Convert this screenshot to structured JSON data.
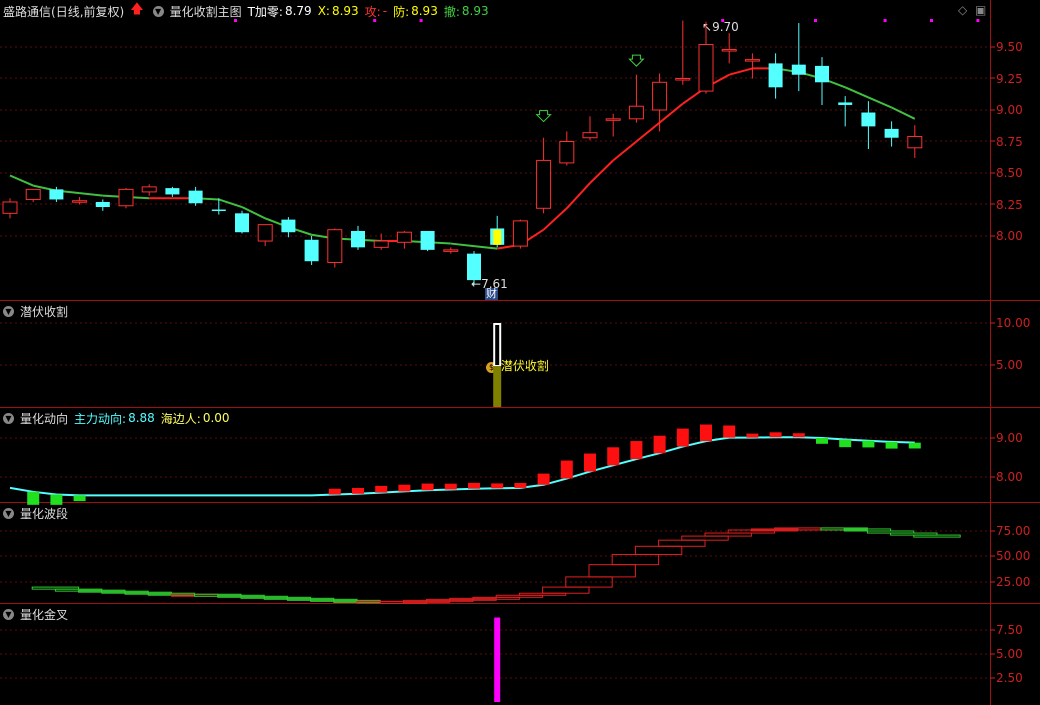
{
  "main": {
    "stock": "盛路通信",
    "period": "(日线,前复权)",
    "indicator": "量化收割主图",
    "t_label": "T加零:",
    "t_value": "8.79",
    "x_label": "X:",
    "x_value": "8.93",
    "gong_label": "攻:",
    "gong_value": "-",
    "fang_label": "防:",
    "fang_value": "8.93",
    "che_label": "撤:",
    "che_value": "8.93",
    "high_marker": "9.70",
    "low_marker": "7.61",
    "cai_label": "财",
    "y_ticks": [
      "9.50",
      "9.25",
      "9.00",
      "8.75",
      "8.50",
      "8.25",
      "8.00"
    ]
  },
  "pane2": {
    "title": "潜伏收割",
    "signal_label": "潜伏收割",
    "y_ticks": [
      "10.00",
      "5.00"
    ]
  },
  "pane3": {
    "title": "量化动向",
    "s1_label": "主力动向:",
    "s1_value": "8.88",
    "s2_label": "海边人:",
    "s2_value": "0.00",
    "y_ticks": [
      "9.00",
      "8.00"
    ]
  },
  "pane4": {
    "title": "量化波段",
    "y_ticks": [
      "75.00",
      "50.00",
      "25.00"
    ]
  },
  "pane5": {
    "title": "量化金叉",
    "y_ticks": [
      "7.50",
      "5.00",
      "2.50"
    ]
  },
  "colors": {
    "up": "#ff3030",
    "down": "#54ffff",
    "ma_up": "#ff2020",
    "ma_down": "#40c040",
    "magenta": "#ff00ff",
    "yellow": "#ffff00",
    "axis": "#cc2020"
  },
  "chart_data": {
    "type": "candlestick",
    "candles": [
      {
        "o": 8.18,
        "h": 8.3,
        "l": 8.14,
        "c": 8.27
      },
      {
        "o": 8.29,
        "h": 8.37,
        "l": 8.27,
        "c": 8.37
      },
      {
        "o": 8.37,
        "h": 8.39,
        "l": 8.27,
        "c": 8.29
      },
      {
        "o": 8.27,
        "h": 8.31,
        "l": 8.25,
        "c": 8.28
      },
      {
        "o": 8.27,
        "h": 8.29,
        "l": 8.2,
        "c": 8.23
      },
      {
        "o": 8.24,
        "h": 8.38,
        "l": 8.22,
        "c": 8.37
      },
      {
        "o": 8.35,
        "h": 8.41,
        "l": 8.32,
        "c": 8.39
      },
      {
        "o": 8.38,
        "h": 8.39,
        "l": 8.31,
        "c": 8.33
      },
      {
        "o": 8.36,
        "h": 8.39,
        "l": 8.24,
        "c": 8.26
      },
      {
        "o": 8.21,
        "h": 8.3,
        "l": 8.17,
        "c": 8.2
      },
      {
        "o": 8.18,
        "h": 8.2,
        "l": 8.02,
        "c": 8.03
      },
      {
        "o": 7.96,
        "h": 8.09,
        "l": 7.92,
        "c": 8.09
      },
      {
        "o": 8.13,
        "h": 8.15,
        "l": 7.99,
        "c": 8.03
      },
      {
        "o": 7.97,
        "h": 8.0,
        "l": 7.77,
        "c": 7.8
      },
      {
        "o": 7.79,
        "h": 8.06,
        "l": 7.75,
        "c": 8.05
      },
      {
        "o": 8.04,
        "h": 8.08,
        "l": 7.89,
        "c": 7.91
      },
      {
        "o": 7.91,
        "h": 8.02,
        "l": 7.89,
        "c": 7.96
      },
      {
        "o": 7.95,
        "h": 8.04,
        "l": 7.9,
        "c": 8.03
      },
      {
        "o": 8.04,
        "h": 8.04,
        "l": 7.88,
        "c": 7.89
      },
      {
        "o": 7.89,
        "h": 7.91,
        "l": 7.86,
        "c": 7.89
      },
      {
        "o": 7.86,
        "h": 7.88,
        "l": 7.61,
        "c": 7.65
      },
      {
        "o": 8.06,
        "h": 8.16,
        "l": 7.91,
        "c": 7.93
      },
      {
        "o": 7.92,
        "h": 8.13,
        "l": 7.9,
        "c": 8.12
      },
      {
        "o": 8.22,
        "h": 8.78,
        "l": 8.18,
        "c": 8.6
      },
      {
        "o": 8.58,
        "h": 8.83,
        "l": 8.56,
        "c": 8.75
      },
      {
        "o": 8.78,
        "h": 8.95,
        "l": 8.76,
        "c": 8.82
      },
      {
        "o": 8.93,
        "h": 8.97,
        "l": 8.79,
        "c": 8.93
      },
      {
        "o": 8.93,
        "h": 9.28,
        "l": 8.9,
        "c": 9.03
      },
      {
        "o": 9.0,
        "h": 9.29,
        "l": 8.83,
        "c": 9.22
      },
      {
        "o": 9.25,
        "h": 9.71,
        "l": 9.2,
        "c": 9.25
      },
      {
        "o": 9.15,
        "h": 9.7,
        "l": 9.13,
        "c": 9.52
      },
      {
        "o": 9.48,
        "h": 9.61,
        "l": 9.37,
        "c": 9.48
      },
      {
        "o": 9.4,
        "h": 9.45,
        "l": 9.25,
        "c": 9.4
      },
      {
        "o": 9.37,
        "h": 9.45,
        "l": 9.09,
        "c": 9.18
      },
      {
        "o": 9.36,
        "h": 9.69,
        "l": 9.15,
        "c": 9.28
      },
      {
        "o": 9.35,
        "h": 9.42,
        "l": 9.04,
        "c": 9.22
      },
      {
        "o": 9.06,
        "h": 9.11,
        "l": 8.87,
        "c": 9.04
      },
      {
        "o": 8.98,
        "h": 9.07,
        "l": 8.69,
        "c": 8.87
      },
      {
        "o": 8.85,
        "h": 8.91,
        "l": 8.71,
        "c": 8.78
      },
      {
        "o": 8.7,
        "h": 8.88,
        "l": 8.62,
        "c": 8.79
      }
    ],
    "ma": [
      8.48,
      8.4,
      8.36,
      8.34,
      8.32,
      8.31,
      8.3,
      8.3,
      8.3,
      8.29,
      8.23,
      8.14,
      8.07,
      8.01,
      7.98,
      7.97,
      7.96,
      7.96,
      7.95,
      7.94,
      7.92,
      7.9,
      7.93,
      8.05,
      8.22,
      8.42,
      8.6,
      8.75,
      8.9,
      9.05,
      9.18,
      9.28,
      9.33,
      9.33,
      9.3,
      9.25,
      9.18,
      9.1,
      9.02,
      8.93
    ],
    "pane2_bar": {
      "index": 21,
      "value": 10.0
    },
    "pane3_line": [
      7.72,
      7.62,
      7.55,
      7.53,
      7.53,
      7.53,
      7.53,
      7.53,
      7.53,
      7.53,
      7.53,
      7.53,
      7.53,
      7.53,
      7.55,
      7.57,
      7.6,
      7.63,
      7.66,
      7.68,
      7.7,
      7.71,
      7.72,
      7.8,
      7.96,
      8.14,
      8.3,
      8.46,
      8.61,
      8.78,
      8.92,
      9.01,
      9.01,
      9.02,
      9.02,
      9.0,
      8.96,
      8.93,
      8.9,
      8.88
    ],
    "pane5_bar": {
      "index": 21,
      "value": 8.8
    }
  }
}
